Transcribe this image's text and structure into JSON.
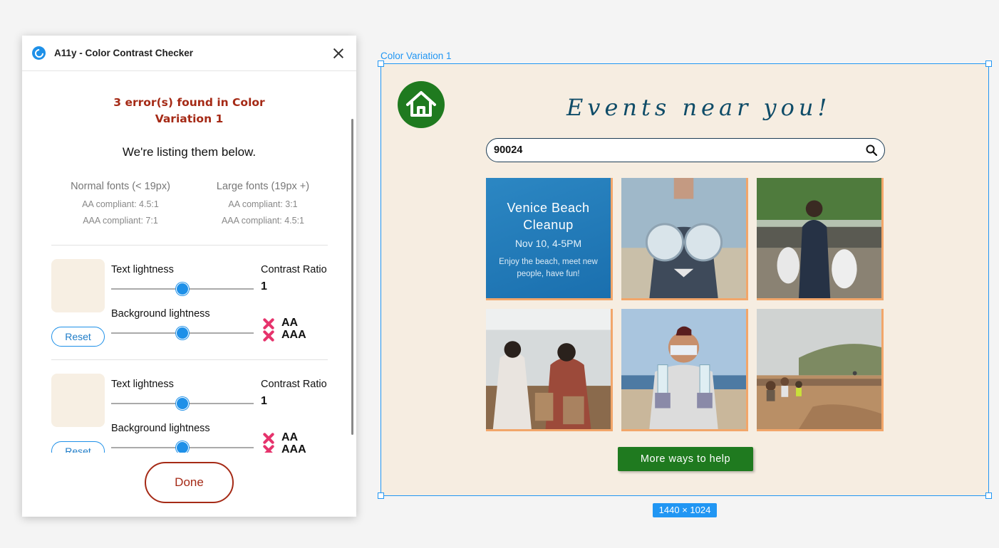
{
  "plugin": {
    "title": "A11y - Color Contrast Checker",
    "error_heading": "3 error(s) found in Color Variation 1",
    "listing_text": "We're listing them below.",
    "criteria": {
      "normal": {
        "title": "Normal fonts (< 19px)",
        "aa": "AA compliant: 4.5:1",
        "aaa": "AAA compliant: 7:1"
      },
      "large": {
        "title": "Large fonts (19px +)",
        "aa": "AA compliant: 3:1",
        "aaa": "AAA compliant: 4.5:1"
      }
    },
    "entries": [
      {
        "text_label": "Text lightness",
        "bg_label": "Background lightness",
        "ratio_label": "Contrast Ratio",
        "ratio_value": "1",
        "reset_label": "Reset",
        "aa_label": "AA",
        "aaa_label": "AAA",
        "text_lightness": 0.5,
        "bg_lightness": 0.5,
        "swatch_color": "#f7efe3"
      },
      {
        "text_label": "Text lightness",
        "bg_label": "Background lightness",
        "ratio_label": "Contrast Ratio",
        "ratio_value": "1",
        "reset_label": "Reset",
        "aa_label": "AA",
        "aaa_label": "AAA",
        "text_lightness": 0.5,
        "bg_lightness": 0.5,
        "swatch_color": "#f7efe3"
      }
    ],
    "done_label": "Done"
  },
  "canvas": {
    "frame_label": "Color Variation 1",
    "size_badge": "1440 × 1024",
    "design": {
      "title": "Events near you!",
      "search_value": "90024",
      "promo": {
        "title": "Venice Beach Cleanup",
        "date": "Nov 10, 4-5PM",
        "description": "Enjoy the beach, meet new people, have fun!"
      },
      "help_button": "More ways to help"
    }
  },
  "colors": {
    "accent_blue": "#2196f3",
    "error_red": "#a52a16",
    "fail_pink": "#e6336c",
    "brand_green": "#1f7a1f",
    "frame_bg": "#f6ede1",
    "tile_border": "#f2a66a"
  }
}
